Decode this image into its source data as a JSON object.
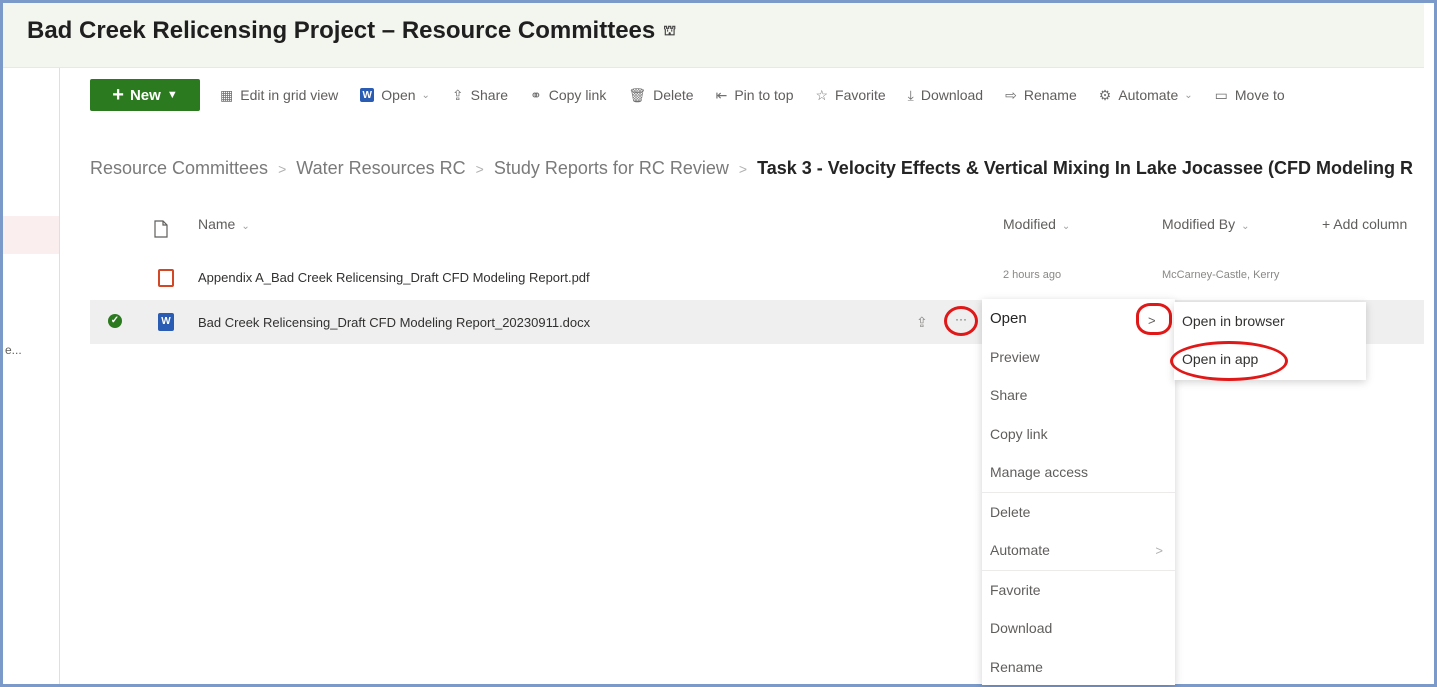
{
  "site": {
    "title": "Bad Creek Relicensing Project – Resource Committees",
    "teams_icon": "teams-icon"
  },
  "leftrail": {
    "truncated_text": "e..."
  },
  "cmdbar": {
    "new_label": "New",
    "items": [
      {
        "label": "Edit in grid view",
        "icon": "▦"
      },
      {
        "label": "Open",
        "icon": "W"
      },
      {
        "label": "Share",
        "icon": "⇪"
      },
      {
        "label": "Copy link",
        "icon": "⚭"
      },
      {
        "label": "Delete",
        "icon": "🗑"
      },
      {
        "label": "Pin to top",
        "icon": "⇤"
      },
      {
        "label": "Favorite",
        "icon": "☆"
      },
      {
        "label": "Download",
        "icon": "⤓"
      },
      {
        "label": "Rename",
        "icon": "⇨"
      },
      {
        "label": "Automate",
        "icon": "⚙"
      },
      {
        "label": "Move to",
        "icon": "▭"
      }
    ]
  },
  "breadcrumb": {
    "items": [
      "Resource Committees",
      "Water Resources RC",
      "Study Reports for RC Review"
    ],
    "current": "Task 3 - Velocity Effects & Vertical Mixing In Lake Jocassee (CFD Modeling R"
  },
  "columns": {
    "name": "Name",
    "modified": "Modified",
    "modified_by": "Modified By",
    "add_column": "+ Add column"
  },
  "files": [
    {
      "name": "Appendix A_Bad Creek Relicensing_Draft CFD Modeling Report.pdf",
      "modified": "2 hours ago",
      "modified_by": "McCarney-Castle, Kerry",
      "type": "pdf"
    },
    {
      "name": "Bad Creek Relicensing_Draft CFD Modeling Report_20230911.docx",
      "modified": "",
      "modified_by": "",
      "type": "docx"
    }
  ],
  "context_menu": {
    "items": [
      "Open",
      "Preview",
      "Share",
      "Copy link",
      "Manage access",
      "Delete",
      "Automate",
      "Favorite",
      "Download",
      "Rename"
    ]
  },
  "submenu": {
    "items": [
      "Open in browser",
      "Open in app"
    ]
  },
  "colors": {
    "new_button": "#2c7a1f",
    "annotation": "#e01818",
    "word_blue": "#2b5cb3",
    "pdf_red": "#d24726"
  }
}
